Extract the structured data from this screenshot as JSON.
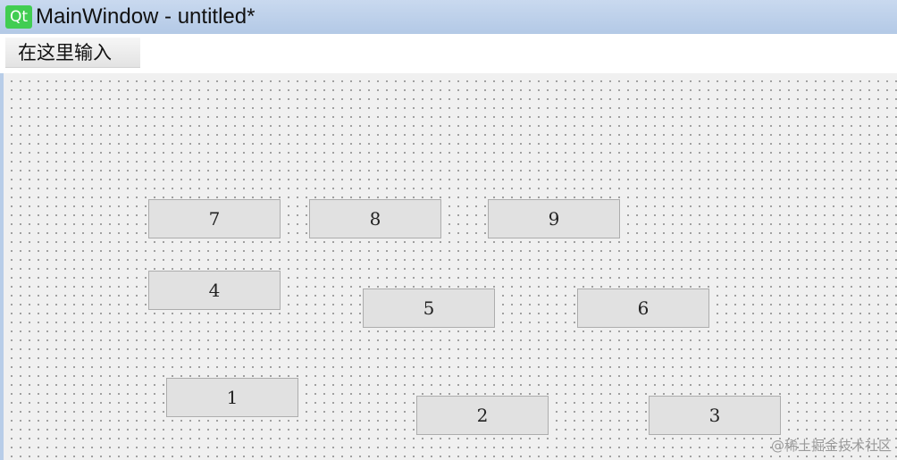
{
  "window": {
    "title": "MainWindow - untitled*",
    "logo_text": "Qt"
  },
  "menubar": {
    "entry_placeholder": "在这里输入"
  },
  "buttons": {
    "b7": "7",
    "b8": "8",
    "b9": "9",
    "b4": "4",
    "b5": "5",
    "b6": "6",
    "b1": "1",
    "b2": "2",
    "b3": "3"
  },
  "watermark": "@稀土掘金技术社区",
  "colors": {
    "titlebar": "#b3c9e6",
    "qt_green": "#41cd52",
    "canvas_bg": "#f0f0f0",
    "button_bg": "#e1e1e1",
    "button_border": "#adadad"
  }
}
